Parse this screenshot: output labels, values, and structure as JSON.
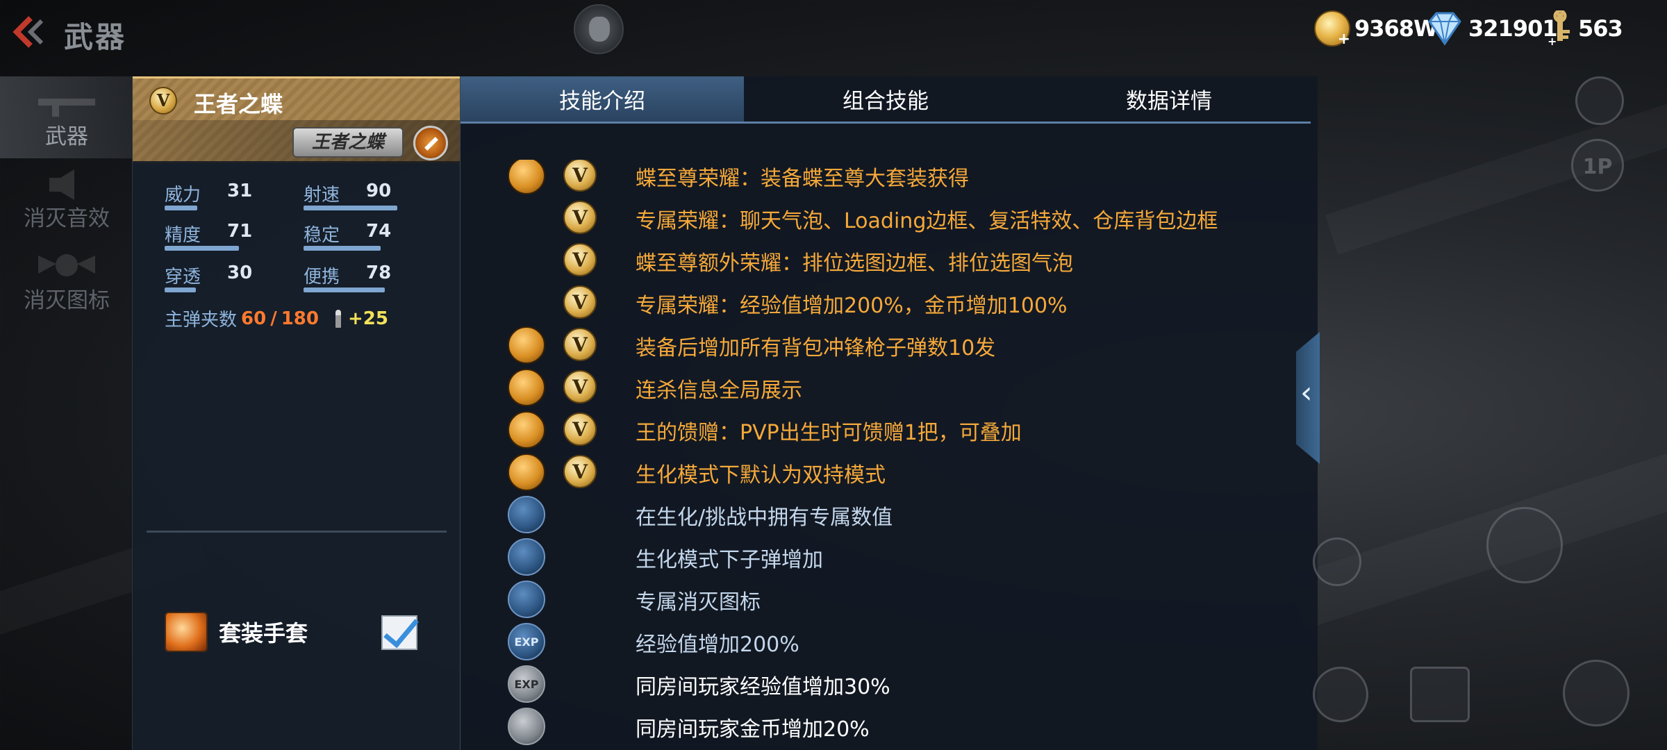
{
  "header": {
    "title": "武器",
    "currencies": [
      {
        "icon": "gold-coin-icon",
        "value": "9368W"
      },
      {
        "icon": "diamond-icon",
        "value": "321901"
      },
      {
        "icon": "key-icon",
        "value": "563"
      }
    ]
  },
  "sidebar": {
    "items": [
      {
        "label": "武器",
        "active": true
      },
      {
        "label": "消灭音效",
        "active": false
      },
      {
        "label": "消灭图标",
        "active": false
      }
    ]
  },
  "weapon": {
    "badge": "V",
    "name": "王者之蝶",
    "logo_text": "王者之蝶",
    "stats": [
      {
        "label": "威力",
        "value": "31",
        "level": 0.31
      },
      {
        "label": "射速",
        "value": "90",
        "level": 0.9
      },
      {
        "label": "精度",
        "value": "71",
        "level": 0.71
      },
      {
        "label": "稳定",
        "value": "74",
        "level": 0.74
      },
      {
        "label": "穿透",
        "value": "30",
        "level": 0.3
      },
      {
        "label": "便携",
        "value": "78",
        "level": 0.78
      }
    ],
    "ammo": {
      "label": "主弹夹数",
      "current": "60",
      "sep": "/",
      "total": "180",
      "bonus": "+25"
    },
    "set": {
      "label": "套装手套",
      "checked": true
    }
  },
  "tabs": [
    "技能介绍",
    "组合技能",
    "数据详情"
  ],
  "active_tab": 0,
  "skills": [
    {
      "icon": "butterfly-icon",
      "icon_style": "gold",
      "v": true,
      "text": "蝶至尊荣耀：装备蝶至尊大套装获得",
      "color": "orange"
    },
    {
      "icon": "",
      "icon_style": "",
      "v": true,
      "text": "专属荣耀：聊天气泡、Loading边框、复活特效、仓库背包边框",
      "color": "orange"
    },
    {
      "icon": "",
      "icon_style": "",
      "v": true,
      "text": "蝶至尊额外荣耀：排位选图边框、排位选图气泡",
      "color": "orange"
    },
    {
      "icon": "",
      "icon_style": "",
      "v": true,
      "text": "专属荣耀：经验值增加200%，金币增加100%",
      "color": "orange"
    },
    {
      "icon": "smg-icon",
      "icon_style": "gold",
      "v": true,
      "text": "装备后增加所有背包冲锋枪子弹数10发",
      "color": "orange"
    },
    {
      "icon": "killfeed-icon",
      "icon_style": "gold",
      "v": true,
      "text": "连杀信息全局展示",
      "color": "orange"
    },
    {
      "icon": "gift-icon",
      "icon_style": "gold",
      "v": true,
      "text": "王的馈赠：PVP出生时可馈赠1把，可叠加",
      "color": "orange"
    },
    {
      "icon": "dual-wield-icon",
      "icon_style": "gold",
      "v": true,
      "text": "生化模式下默认为双持模式",
      "color": "orange"
    },
    {
      "icon": "mutation-icon",
      "icon_style": "blue",
      "v": false,
      "text": "在生化/挑战中拥有专属数值",
      "color": "light"
    },
    {
      "icon": "ammo-up-icon",
      "icon_style": "blue",
      "v": false,
      "text": "生化模式下子弹增加",
      "color": "light"
    },
    {
      "icon": "kill-icon",
      "icon_style": "blue",
      "v": false,
      "text": "专属消灭图标",
      "color": "light"
    },
    {
      "icon": "exp-icon",
      "icon_style": "blue",
      "v": false,
      "text": "经验值增加200%",
      "color": "light",
      "icon_text": "EXP"
    },
    {
      "icon": "room-exp-icon",
      "icon_style": "gray",
      "v": false,
      "text": "同房间玩家经验值增加30%",
      "color": "white",
      "icon_text": "EXP"
    },
    {
      "icon": "room-coin-icon",
      "icon_style": "gray",
      "v": false,
      "text": "同房间玩家金币增加20%",
      "color": "white"
    }
  ],
  "right_buttons": [
    {
      "name": "fire-mode-icon"
    },
    {
      "name": "first-person-button",
      "label": "1P"
    },
    {
      "name": "reload-icon"
    },
    {
      "name": "knife-icon"
    },
    {
      "name": "switch-icon"
    },
    {
      "name": "swap-icon"
    },
    {
      "name": "eye-off-icon"
    }
  ]
}
